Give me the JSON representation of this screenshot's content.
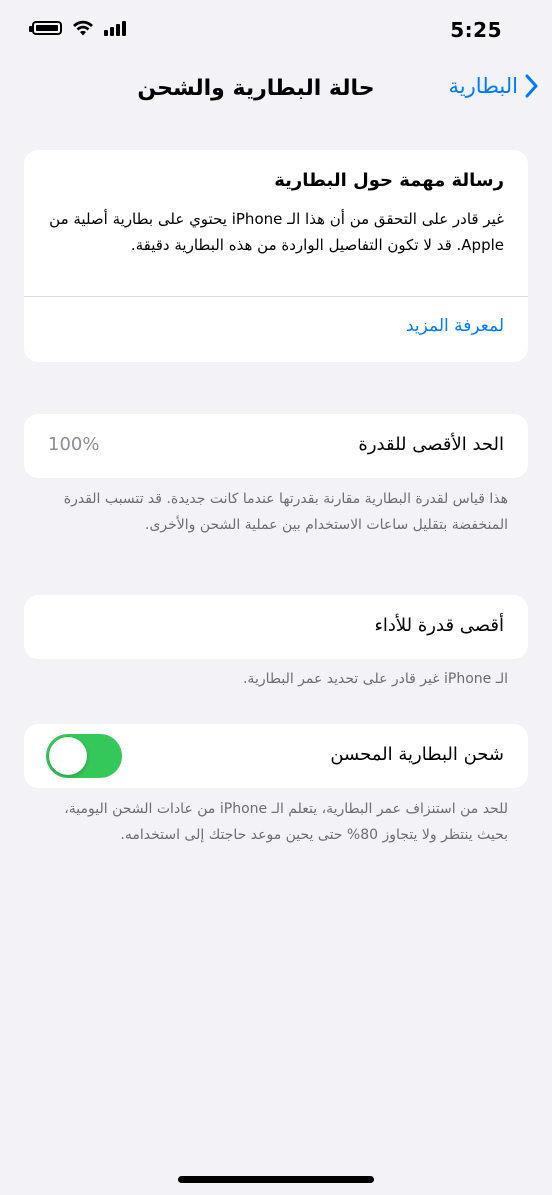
{
  "status_bar": {
    "time": "5:25",
    "icons": [
      "battery-icon",
      "wifi-icon",
      "cellular-signal-icon"
    ]
  },
  "nav": {
    "back_label": "البطارية",
    "title": "حالة البطارية والشحن"
  },
  "important_message": {
    "title": "رسالة مهمة حول البطارية",
    "body": "غير قادر على التحقق من أن هذا الـ iPhone يحتوي على بطارية أصلية من Apple. قد لا تكون التفاصيل الواردة من هذه البطارية دقيقة.",
    "link": "لمعرفة المزيد"
  },
  "maximum_capacity": {
    "label": "الحد الأقصى للقدرة",
    "value": "100%",
    "footnote": "هذا قياس لقدرة البطارية مقارنة بقدرتها عندما كانت جديدة. قد تتسبب القدرة المنخفضة بتقليل ساعات الاستخدام بين عملية الشحن والأخرى."
  },
  "peak_performance": {
    "label": "أقصى قدرة للأداء",
    "footnote": "الـ iPhone غير قادر على تحديد عمر البطارية."
  },
  "optimized_charging": {
    "label": "شحن البطارية المحسن",
    "enabled": true,
    "footnote": "للحد من استنزاف عمر البطارية، يتعلم الـ iPhone من عادات الشحن اليومية، بحيث ينتظر ولا يتجاوز 80% حتى يحين موعد حاجتك إلى استخدامه."
  },
  "colors": {
    "accent": "#007aff",
    "toggle_on": "#34c759",
    "background": "#f2f2f7",
    "secondary_text": "#6d6d72"
  }
}
